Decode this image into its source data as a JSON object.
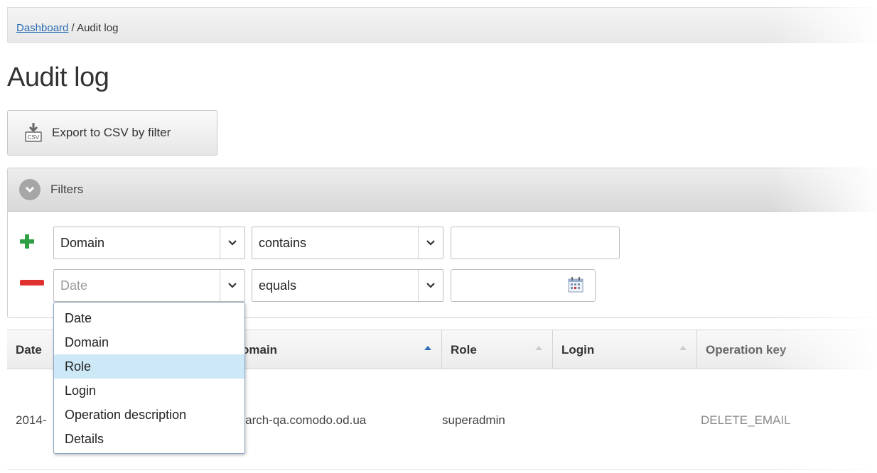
{
  "breadcrumb": {
    "link": "Dashboard",
    "separator": " / ",
    "current": "Audit log"
  },
  "page_title": "Audit log",
  "export_button": {
    "label": "Export to CSV by filter",
    "icon": "csv-icon"
  },
  "filters": {
    "title": "Filters",
    "rows": [
      {
        "field": "Domain",
        "operator": "contains",
        "value": ""
      },
      {
        "field": "Date",
        "operator": "equals",
        "value": ""
      }
    ],
    "colors": {
      "add": "#2ea043",
      "remove": "#e03131"
    }
  },
  "dropdown_options": [
    "Date",
    "Domain",
    "Role",
    "Login",
    "Operation description",
    "Details"
  ],
  "dropdown_highlighted": "Role",
  "table": {
    "columns": [
      "Date",
      "Domain",
      "Role",
      "Login",
      "Operation key"
    ],
    "visible_header_fragments": {
      "domain": "omain",
      "operation_key": "Operation key"
    },
    "rows": [
      {
        "date": "2014-",
        "domain": "g-arch-qa.comodo.od.ua",
        "role": "superadmin",
        "login": "",
        "operation_key": "DELETE_EMAIL"
      }
    ]
  }
}
